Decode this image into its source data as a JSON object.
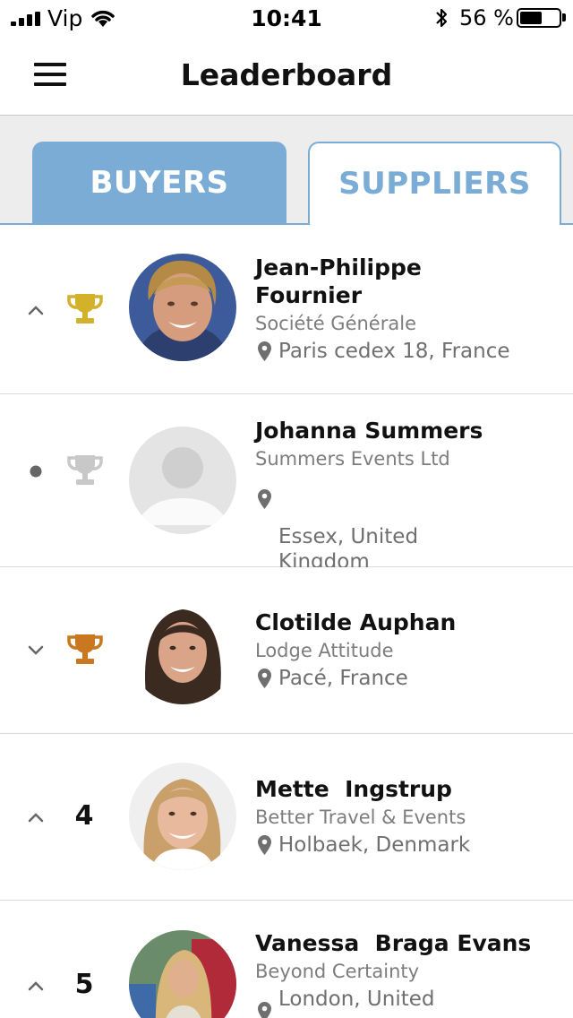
{
  "status_bar": {
    "carrier": "Vip",
    "time": "10:41",
    "battery_percent": "56 %",
    "battery_level": 0.56,
    "signal_bars": 4,
    "icons": [
      "signal-icon",
      "wifi-icon",
      "bluetooth-icon",
      "battery-icon"
    ]
  },
  "header": {
    "title": "Leaderboard",
    "menu_icon": "hamburger-menu-icon"
  },
  "tabs": [
    {
      "label": "BUYERS",
      "active": true
    },
    {
      "label": "SUPPLIERS",
      "active": false
    }
  ],
  "colors": {
    "accent": "#7aacd6",
    "gold": "#d4b12a",
    "silver": "#c8c8c8",
    "bronze": "#c9781f",
    "text_secondary": "#7d7d7d"
  },
  "leaders": [
    {
      "trend": "up",
      "rank_display": "trophy-gold",
      "name": "Jean-Philippe\nFournier",
      "company": "Société Générale",
      "location": "Paris cedex 18, France",
      "avatar": "photo"
    },
    {
      "trend": "same",
      "rank_display": "trophy-silver",
      "name": "Johanna Summers",
      "company": "Summers Events Ltd",
      "location": "Essex, United\nKingdom",
      "avatar": "placeholder"
    },
    {
      "trend": "down",
      "rank_display": "trophy-bronze",
      "name": "Clotilde Auphan",
      "company": "Lodge Attitude",
      "location": "Pacé, France",
      "avatar": "photo"
    },
    {
      "trend": "up",
      "rank_display": "4",
      "name": "Mette  Ingstrup",
      "company": "Better Travel & Events",
      "location": "Holbaek, Denmark",
      "avatar": "photo"
    },
    {
      "trend": "up",
      "rank_display": "5",
      "name": "Vanessa  Braga Evans",
      "company": "Beyond Certainty",
      "location": "London, United",
      "avatar": "photo"
    }
  ]
}
